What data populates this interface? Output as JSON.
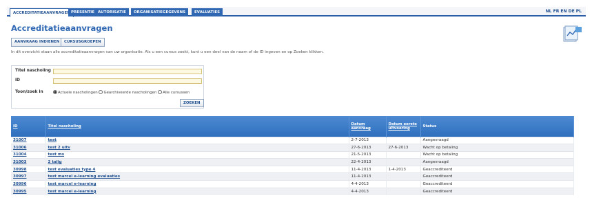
{
  "nav": {
    "tabs": [
      {
        "label": "Accreditatieaanvragen"
      },
      {
        "label": "Presentie"
      },
      {
        "label": "Autorisatie"
      },
      {
        "label": "Organisatiegegevens"
      },
      {
        "label": "Evaluaties"
      }
    ],
    "languages": "NL FR EN DE PL"
  },
  "page": {
    "title": "Accreditatieaanvragen",
    "buttons": {
      "new_request": "Aanvraag indienen",
      "course_groups": "Cursusgroepen"
    },
    "intro": "In dit overzicht staan alle accreditatieaanvragen van uw organisatie. Als u een cursus zoekt, kunt u een deel van de naam of de ID ingeven en op Zoeken klikken."
  },
  "search": {
    "title_label": "Titel nascholing",
    "title_value": "",
    "id_label": "ID",
    "id_value": "",
    "filter_label": "Toon/zoek in",
    "options": [
      "Actuele nascholingen",
      "Gearchiveerde nascholingen",
      "Alle cursussen"
    ],
    "selected": "Actuele nascholingen",
    "submit": "Zoeken"
  },
  "table": {
    "headers": {
      "id": "ID",
      "title": "Titel nascholing",
      "date_request": "Datum aanvraag",
      "date_first": "Datum eerste uitvoering",
      "status": "Status"
    },
    "rows": [
      {
        "id": "31007",
        "title": "test",
        "date_request": "2-7-2013",
        "date_first": "",
        "status": "Aangevraagd"
      },
      {
        "id": "31006",
        "title": "test 2 uitv",
        "date_request": "27-6-2013",
        "date_first": "27-6-2013",
        "status": "Wacht op betaling"
      },
      {
        "id": "31004",
        "title": "test ms",
        "date_request": "21-5-2013",
        "date_first": "",
        "status": "Wacht op betaling"
      },
      {
        "id": "31003",
        "title": "2 talig",
        "date_request": "22-4-2013",
        "date_first": "",
        "status": "Aangevraagd"
      },
      {
        "id": "30998",
        "title": "test evaluaties type 4",
        "date_request": "11-4-2013",
        "date_first": "1-4-2013",
        "status": "Geaccrediteerd"
      },
      {
        "id": "30997",
        "title": "test marcel e-learning evaluaties",
        "date_request": "11-4-2013",
        "date_first": "",
        "status": "Geaccrediteerd"
      },
      {
        "id": "30996",
        "title": "test marcel e-learning",
        "date_request": "4-4-2013",
        "date_first": "",
        "status": "Geaccrediteerd"
      },
      {
        "id": "30995",
        "title": "test marcel e-learning",
        "date_request": "4-4-2013",
        "date_first": "",
        "status": "Geaccrediteerd"
      }
    ]
  }
}
